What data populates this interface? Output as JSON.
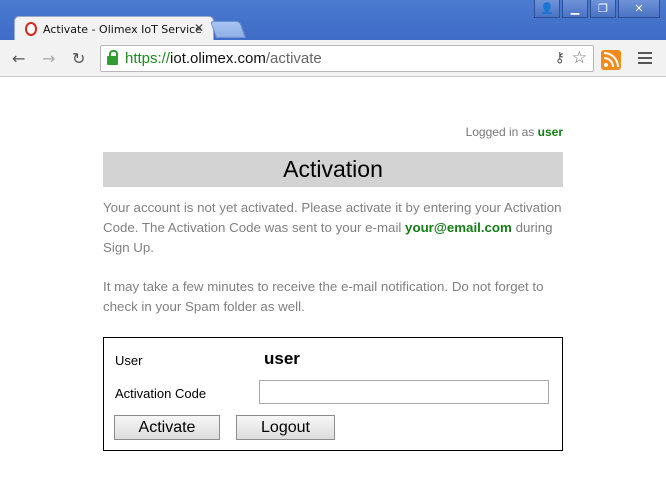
{
  "browser": {
    "tab_title": "Activate - Olimex IoT Service",
    "url": {
      "scheme": "https://",
      "host": "iot.olimex.com",
      "path": "/activate"
    },
    "window_buttons": [
      "user-icon",
      "minimize-icon",
      "maximize-icon",
      "close-icon"
    ]
  },
  "header": {
    "logged_in_prefix": "Logged in as ",
    "username": "user"
  },
  "page": {
    "title": "Activation",
    "paragraph1_before": "Your account is not yet activated. Please activate it by entering your Activation Code. The Activation Code was sent to your e-mail ",
    "email": "your@email.com",
    "paragraph1_after": " during Sign Up.",
    "paragraph2": "It may take a few minutes to receive the e-mail notification. Do not forget to check in your Spam folder as well."
  },
  "form": {
    "user_label": "User",
    "user_value": "user",
    "code_label": "Activation Code",
    "code_value": "",
    "activate_button": "Activate",
    "logout_button": "Logout"
  },
  "colors": {
    "accent_green": "#157c15",
    "heading_bg": "#d3d3d3"
  }
}
